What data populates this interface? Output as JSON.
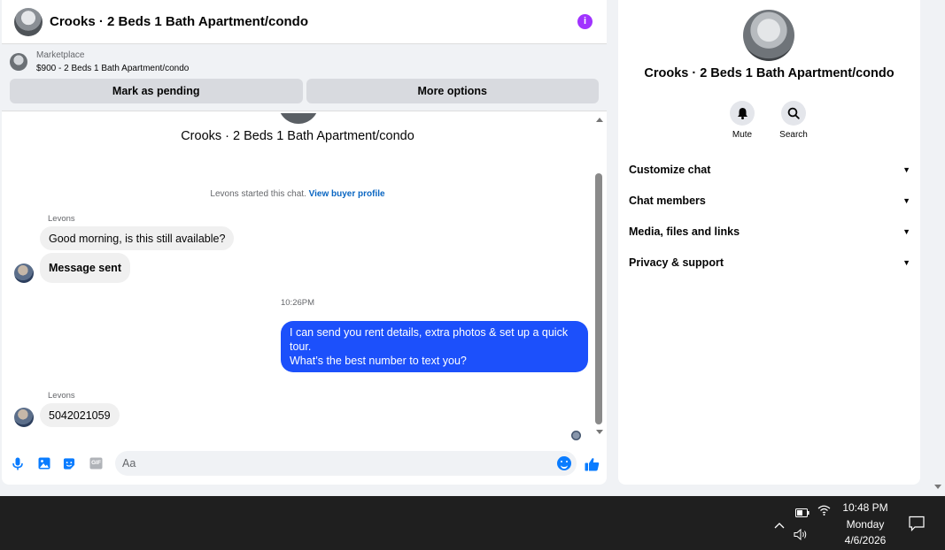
{
  "chat": {
    "title": "Crooks · 2 Beds 1 Bath Apartment/condo",
    "marketplace": {
      "label": "Marketplace",
      "listing": "$900 - 2 Beds 1 Bath Apartment/condo",
      "buttons": [
        "Mark as pending",
        "More options"
      ]
    },
    "center_title": "Crooks · 2 Beds 1 Bath Apartment/condo",
    "started_text": "Levons started this chat.",
    "started_link": "View buyer profile",
    "messages": [
      {
        "sender": "Levons",
        "text": "Good morning, is this still available?"
      },
      {
        "text": "Message sent"
      },
      {
        "time": "10:26PM"
      },
      {
        "text": "I can send you rent details, extra photos & set up a quick tour.",
        "text2": "What’s the best number to text you?"
      },
      {
        "sender": "Levons",
        "text": "5042021059"
      }
    ],
    "composer": {
      "placeholder": "Aa",
      "gif_label": "GIF"
    }
  },
  "info": {
    "title": "Crooks · 2 Beds 1 Bath Apartment/condo",
    "actions": [
      {
        "label": "Mute",
        "icon": "bell-icon"
      },
      {
        "label": "Search",
        "icon": "search-icon"
      }
    ],
    "sections": [
      "Customize chat",
      "Chat members",
      "Media, files and links",
      "Privacy & support"
    ]
  },
  "taskbar": {
    "time": "10:48 PM",
    "day": "Monday",
    "date": "4/6/2026"
  },
  "colors": {
    "accent": "#1c50fb",
    "info_icon": "#a033ff",
    "link": "#0a66c2"
  }
}
